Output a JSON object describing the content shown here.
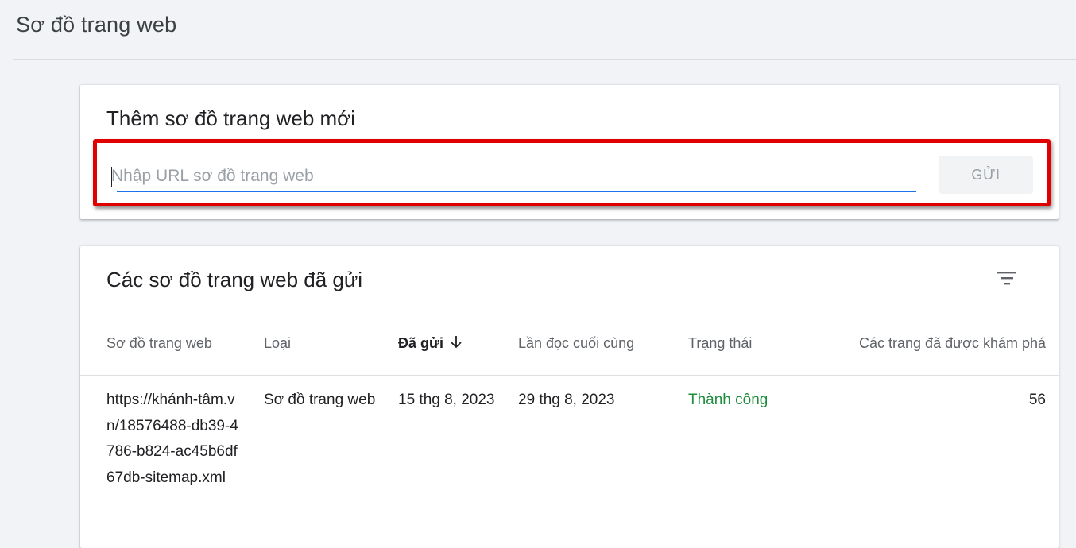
{
  "page": {
    "title": "Sơ đồ trang web"
  },
  "add_sitemap": {
    "title": "Thêm sơ đồ trang web mới",
    "input_placeholder": "Nhập URL sơ đồ trang web",
    "input_value": "",
    "submit_label": "GỬI"
  },
  "submitted": {
    "title": "Các sơ đồ trang web đã gửi",
    "columns": [
      "Sơ đồ trang web",
      "Loại",
      "Đã gửi",
      "Lần đọc cuối cùng",
      "Trạng thái",
      "Các trang đã được khám phá"
    ],
    "rows": [
      {
        "sitemap": "https://khánh-tâm.vn/18576488-db39-4786-b824-ac45b6df67db-sitemap.xml",
        "type": "Sơ đồ trang web",
        "submitted": "15 thg 8, 2023",
        "last_read": "29 thg 8, 2023",
        "status": "Thành công",
        "discovered_pages": "56"
      }
    ]
  },
  "colors": {
    "accent": "#1a73e8",
    "success": "#1e8e3e",
    "highlight": "#e00000"
  },
  "icons": [
    "filter-icon",
    "arrow-down-icon"
  ]
}
